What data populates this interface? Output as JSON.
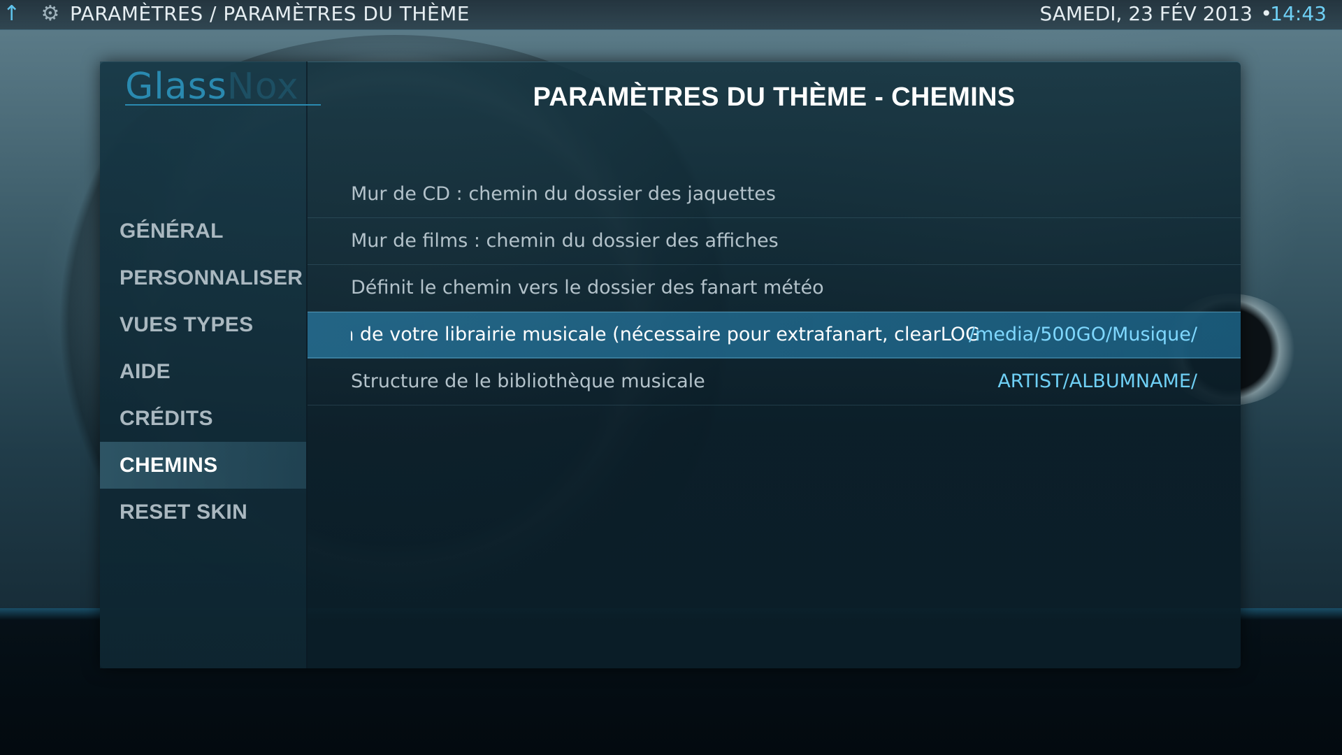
{
  "topbar": {
    "breadcrumb": "PARAMÈTRES / PARAMÈTRES DU THÈME",
    "date": "SAMEDI, 23 FÉV 2013",
    "separator": "•",
    "time": "14:43"
  },
  "sidebar": {
    "logo": {
      "text_left": "Glass",
      "text_right": "Nox"
    },
    "items": [
      {
        "label": "GÉNÉRAL",
        "active": false
      },
      {
        "label": "PERSONNALISER",
        "active": false
      },
      {
        "label": "VUES TYPES",
        "active": false
      },
      {
        "label": "AIDE",
        "active": false
      },
      {
        "label": "CRÉDITS",
        "active": false
      },
      {
        "label": "CHEMINS",
        "active": true
      },
      {
        "label": "RESET SKIN",
        "active": false
      }
    ]
  },
  "main": {
    "title": "PARAMÈTRES DU THÈME - CHEMINS",
    "rows": [
      {
        "label": "Mur de CD : chemin du dossier des jaquettes",
        "value": ""
      },
      {
        "label": "Mur de films : chemin du dossier des affiches",
        "value": ""
      },
      {
        "label": "Définit le chemin vers le dossier des fanart météo",
        "value": ""
      },
      {
        "label": "e chemin de votre librairie musicale (nécessaire pour extrafanart, clearLOG",
        "value": "/media/500GO/Musique/",
        "focused": true
      },
      {
        "label": "Structure de le bibliothèque musicale",
        "value": "ARTIST/ALBUMNAME/"
      }
    ]
  },
  "icons": {
    "up": "up-arrow-icon",
    "settings": "gear-icon"
  },
  "colors": {
    "accent": "#6fd0f5",
    "focus_row": "#2a7fa8"
  }
}
